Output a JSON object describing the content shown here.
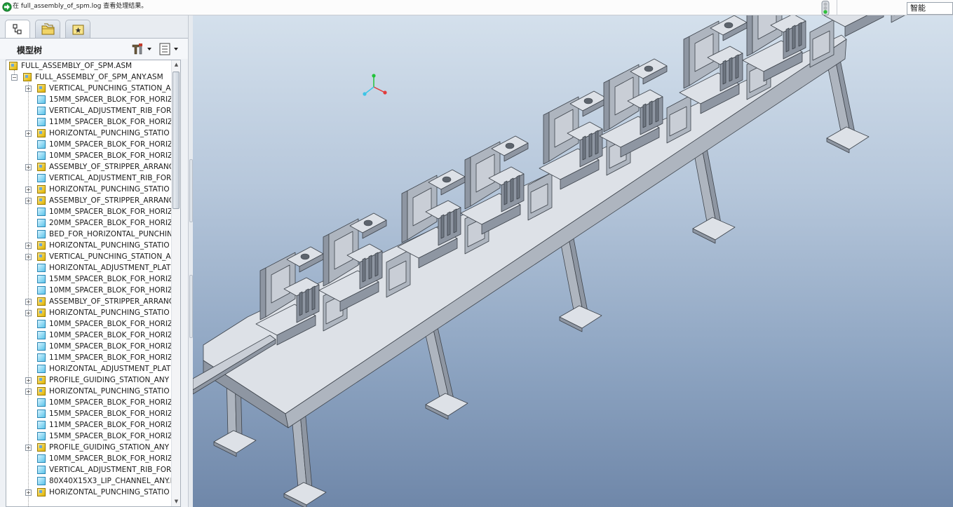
{
  "message_bar": {
    "text": "在 full_assembly_of_spm.log 查看处理结果。",
    "filter_value": "智能"
  },
  "navigator": {
    "tabs": [
      {
        "name": "model-tree",
        "icon": "model-tree-icon",
        "active": true
      },
      {
        "name": "folder-browser",
        "icon": "folder-icon",
        "active": false
      },
      {
        "name": "favorites",
        "icon": "favorites-icon",
        "active": false
      }
    ],
    "tree_title": "模型树",
    "settings_icon": "tools-icon",
    "show_icon": "list-icon",
    "rows": [
      {
        "label": "FULL_ASSEMBLY_OF_SPM.ASM",
        "type": "asm",
        "level": 0,
        "expander": "none"
      },
      {
        "label": "FULL_ASSEMBLY_OF_SPM_ANY.ASM",
        "type": "asm",
        "level": 1,
        "expander": "minus"
      },
      {
        "label": "VERTICAL_PUNCHING_STATION_A",
        "type": "asm",
        "level": 2,
        "expander": "plus"
      },
      {
        "label": "15MM_SPACER_BLOK_FOR_HORIZ",
        "type": "prt",
        "level": 2,
        "expander": "none"
      },
      {
        "label": "VERTICAL_ADJUSTMENT_RIB_FOR",
        "type": "prt",
        "level": 2,
        "expander": "none"
      },
      {
        "label": "11MM_SPACER_BLOK_FOR_HORIZ",
        "type": "prt",
        "level": 2,
        "expander": "none"
      },
      {
        "label": "HORIZONTAL_PUNCHING_STATIO",
        "type": "asm",
        "level": 2,
        "expander": "plus"
      },
      {
        "label": "10MM_SPACER_BLOK_FOR_HORIZ",
        "type": "prt",
        "level": 2,
        "expander": "none"
      },
      {
        "label": "10MM_SPACER_BLOK_FOR_HORIZ",
        "type": "prt",
        "level": 2,
        "expander": "none"
      },
      {
        "label": "ASSEMBLY_OF_STRIPPER_ARRANG",
        "type": "asm",
        "level": 2,
        "expander": "plus"
      },
      {
        "label": "VERTICAL_ADJUSTMENT_RIB_FOR",
        "type": "prt",
        "level": 2,
        "expander": "none"
      },
      {
        "label": "HORIZONTAL_PUNCHING_STATIO",
        "type": "asm",
        "level": 2,
        "expander": "plus"
      },
      {
        "label": "ASSEMBLY_OF_STRIPPER_ARRANG",
        "type": "asm",
        "level": 2,
        "expander": "plus"
      },
      {
        "label": "10MM_SPACER_BLOK_FOR_HORIZ",
        "type": "prt",
        "level": 2,
        "expander": "none"
      },
      {
        "label": "20MM_SPACER_BLOK_FOR_HORIZ",
        "type": "prt",
        "level": 2,
        "expander": "none"
      },
      {
        "label": "BED_FOR_HORIZONTAL_PUNCHIN",
        "type": "prt",
        "level": 2,
        "expander": "none"
      },
      {
        "label": "HORIZONTAL_PUNCHING_STATIO",
        "type": "asm",
        "level": 2,
        "expander": "plus"
      },
      {
        "label": "VERTICAL_PUNCHING_STATION_A",
        "type": "asm",
        "level": 2,
        "expander": "plus"
      },
      {
        "label": "HORIZONTAL_ADJUSTMENT_PLAT",
        "type": "prt",
        "level": 2,
        "expander": "none"
      },
      {
        "label": "15MM_SPACER_BLOK_FOR_HORIZ",
        "type": "prt",
        "level": 2,
        "expander": "none"
      },
      {
        "label": "10MM_SPACER_BLOK_FOR_HORIZ",
        "type": "prt",
        "level": 2,
        "expander": "none"
      },
      {
        "label": "ASSEMBLY_OF_STRIPPER_ARRANG",
        "type": "asm",
        "level": 2,
        "expander": "plus"
      },
      {
        "label": "HORIZONTAL_PUNCHING_STATIO",
        "type": "asm",
        "level": 2,
        "expander": "plus"
      },
      {
        "label": "10MM_SPACER_BLOK_FOR_HORIZ",
        "type": "prt",
        "level": 2,
        "expander": "none"
      },
      {
        "label": "10MM_SPACER_BLOK_FOR_HORIZ",
        "type": "prt",
        "level": 2,
        "expander": "none"
      },
      {
        "label": "10MM_SPACER_BLOK_FOR_HORIZ",
        "type": "prt",
        "level": 2,
        "expander": "none"
      },
      {
        "label": "11MM_SPACER_BLOK_FOR_HORIZ",
        "type": "prt",
        "level": 2,
        "expander": "none"
      },
      {
        "label": "HORIZONTAL_ADJUSTMENT_PLAT",
        "type": "prt",
        "level": 2,
        "expander": "none"
      },
      {
        "label": "PROFILE_GUIDING_STATION_ANY",
        "type": "asm",
        "level": 2,
        "expander": "plus"
      },
      {
        "label": "HORIZONTAL_PUNCHING_STATIO",
        "type": "asm",
        "level": 2,
        "expander": "plus"
      },
      {
        "label": "10MM_SPACER_BLOK_FOR_HORIZ",
        "type": "prt",
        "level": 2,
        "expander": "none"
      },
      {
        "label": "15MM_SPACER_BLOK_FOR_HORIZ",
        "type": "prt",
        "level": 2,
        "expander": "none"
      },
      {
        "label": "11MM_SPACER_BLOK_FOR_HORIZ",
        "type": "prt",
        "level": 2,
        "expander": "none"
      },
      {
        "label": "15MM_SPACER_BLOK_FOR_HORIZ",
        "type": "prt",
        "level": 2,
        "expander": "none"
      },
      {
        "label": "PROFILE_GUIDING_STATION_ANY",
        "type": "asm",
        "level": 2,
        "expander": "plus"
      },
      {
        "label": "10MM_SPACER_BLOK_FOR_HORIZ",
        "type": "prt",
        "level": 2,
        "expander": "none"
      },
      {
        "label": "VERTICAL_ADJUSTMENT_RIB_FOR",
        "type": "prt",
        "level": 2,
        "expander": "none"
      },
      {
        "label": "80X40X15X3_LIP_CHANNEL_ANY.P",
        "type": "prt",
        "level": 2,
        "expander": "none"
      },
      {
        "label": "HORIZONTAL_PUNCHING_STATIO",
        "type": "asm",
        "level": 2,
        "expander": "plus"
      }
    ]
  },
  "viewport": {
    "background_top": "#d4e0ec",
    "background_bottom": "#6f87a9",
    "model_color": "#c9ced6",
    "triad_colors": {
      "x": "#e23b3b",
      "y": "#22c33a",
      "z": "#3cc4e6"
    }
  }
}
